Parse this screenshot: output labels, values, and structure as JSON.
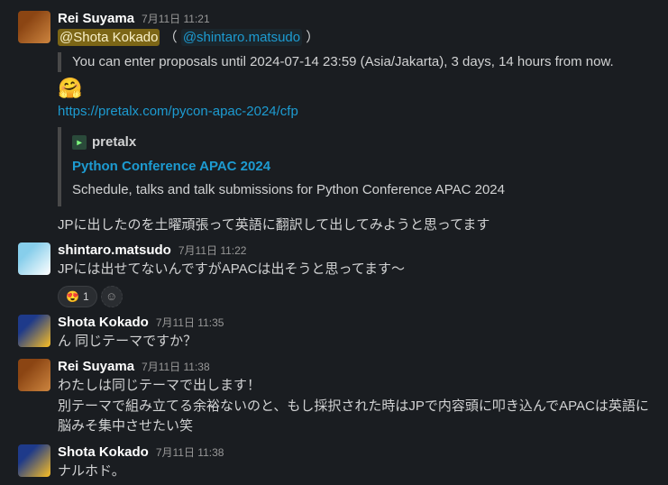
{
  "messages": [
    {
      "author": "Rei Suyama",
      "timestamp": "7月11日 11:21",
      "mentions": {
        "highlight": "@Shota Kokado",
        "link": "@shintaro.matsudo"
      },
      "quote": "You can enter proposals until 2024-07-14 23:59 (Asia/Jakarta), 3 days, 14 hours from now.",
      "emoji": "🤗",
      "url": "https://pretalx.com/pycon-apac-2024/cfp",
      "unfurl": {
        "site": "pretalx",
        "title": "Python Conference APAC 2024",
        "desc": "Schedule, talks and talk submissions for Python Conference APAC 2024"
      },
      "body_after": "JPに出したのを土曜頑張って英語に翻訳して出してみようと思ってます"
    },
    {
      "author": "shintaro.matsudo",
      "timestamp": "7月11日 11:22",
      "body": "JPには出せてないんですがAPACは出そうと思ってます〜",
      "reactions": [
        {
          "emoji": "😍",
          "count": "1"
        }
      ]
    },
    {
      "author": "Shota Kokado",
      "timestamp": "7月11日 11:35",
      "body": "ん 同じテーマですか？"
    },
    {
      "author": "Rei Suyama",
      "timestamp": "7月11日 11:38",
      "body": "わたしは同じテーマで出します！\n別テーマで組み立てる余裕ないのと、もし採択された時はJPで内容頭に叩き込んでAPACは英語に脳みそ集中させたい笑"
    },
    {
      "author": "Shota Kokado",
      "timestamp": "7月11日 11:38",
      "body": "ナルホド。"
    }
  ]
}
